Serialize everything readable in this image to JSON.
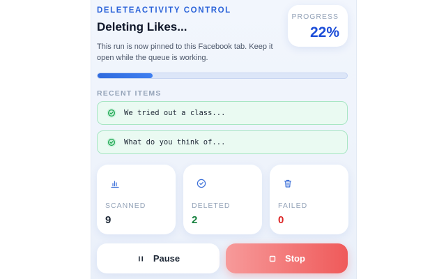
{
  "header": {
    "brand": "DELETEACTIVITY CONTROL",
    "title": "Deleting Likes...",
    "description": "This run is now pinned to this Facebook tab. Keep it open while the queue is working."
  },
  "progress": {
    "label": "PROGRESS",
    "value_text": "22%",
    "percent": 22,
    "bar_color": "#2f6bde",
    "accent_color": "#1d4ed8"
  },
  "recent": {
    "label": "RECENT ITEMS",
    "items": [
      {
        "text": "We tried out a class...",
        "icon": "check-circle-icon",
        "status": "success"
      },
      {
        "text": "What do you think of...",
        "icon": "check-circle-icon",
        "status": "success"
      }
    ],
    "success_color": "#16a34a"
  },
  "stats": {
    "scanned": {
      "label": "SCANNED",
      "value": "9",
      "icon": "bar-chart-icon",
      "color": "#1f2937"
    },
    "deleted": {
      "label": "DELETED",
      "value": "2",
      "icon": "check-circle-icon",
      "color": "#15803d"
    },
    "failed": {
      "label": "FAILED",
      "value": "0",
      "icon": "trash-icon",
      "color": "#dc2626"
    }
  },
  "actions": {
    "pause_label": "Pause",
    "pause_icon": "pause-icon",
    "stop_label": "Stop",
    "stop_icon": "stop-icon",
    "stop_color": "#ef4444"
  }
}
